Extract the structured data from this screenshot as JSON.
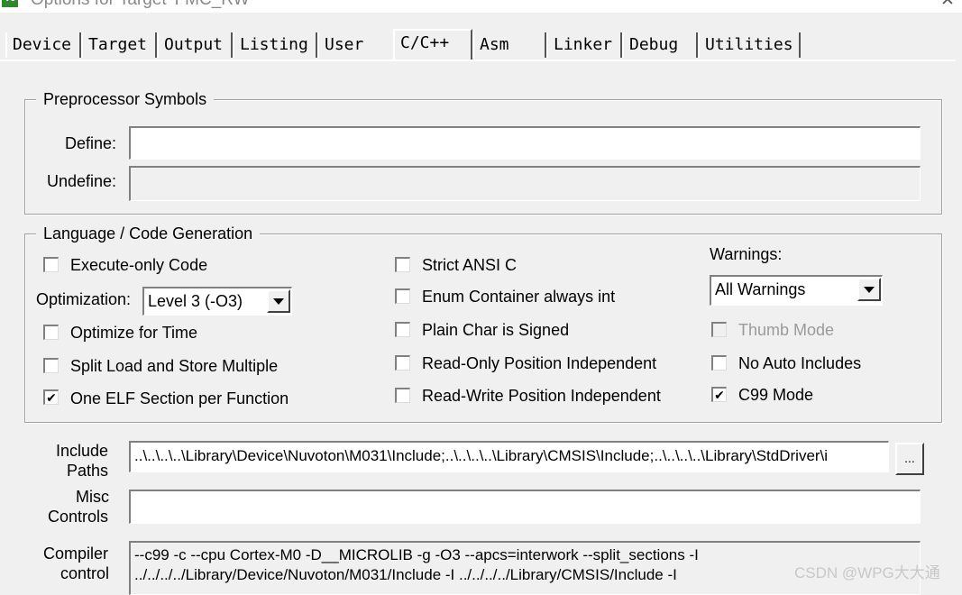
{
  "window": {
    "title": "Options for Target 'FMC_RW'",
    "app_icon": "keil-uvision-icon",
    "close_glyph": "✕"
  },
  "tabs": [
    {
      "label": "Device",
      "active": false
    },
    {
      "label": "Target",
      "active": false
    },
    {
      "label": "Output",
      "active": false
    },
    {
      "label": "Listing",
      "active": false
    },
    {
      "label": "User",
      "active": false
    },
    {
      "label": "C/C++",
      "active": true
    },
    {
      "label": "Asm",
      "active": false
    },
    {
      "label": "Linker",
      "active": false
    },
    {
      "label": "Debug",
      "active": false
    },
    {
      "label": "Utilities",
      "active": false
    }
  ],
  "preprocessor": {
    "title": "Preprocessor Symbols",
    "define_label": "Define:",
    "define_value": "",
    "undefine_label": "Undefine:",
    "undefine_value": ""
  },
  "language": {
    "title": "Language / Code Generation",
    "execute_only": {
      "label": "Execute-only Code",
      "checked": false
    },
    "optimization_label": "Optimization:",
    "optimization_value": "Level 3 (-O3)",
    "optimize_time": {
      "label": "Optimize for Time",
      "checked": false
    },
    "split_load": {
      "label": "Split Load and Store Multiple",
      "checked": false
    },
    "one_elf": {
      "label": "One ELF Section per Function",
      "checked": true
    },
    "strict_ansi": {
      "label": "Strict ANSI C",
      "checked": false
    },
    "enum_container": {
      "label": "Enum Container always int",
      "checked": false
    },
    "plain_char": {
      "label": "Plain Char is Signed",
      "checked": false
    },
    "ro_position": {
      "label": "Read-Only Position Independent",
      "checked": false
    },
    "rw_position": {
      "label": "Read-Write Position Independent",
      "checked": false
    },
    "warnings_label": "Warnings:",
    "warnings_value": "All Warnings",
    "thumb_mode": {
      "label": "Thumb Mode",
      "checked": false,
      "disabled": true
    },
    "no_auto_includes": {
      "label": "No Auto Includes",
      "checked": false
    },
    "c99_mode": {
      "label": "C99 Mode",
      "checked": true
    }
  },
  "include_paths": {
    "label_line1": "Include",
    "label_line2": "Paths",
    "value": "..\\..\\..\\..\\Library\\Device\\Nuvoton\\M031\\Include;..\\..\\..\\..\\Library\\CMSIS\\Include;..\\..\\..\\..\\Library\\StdDriver\\i",
    "browse_label": "..."
  },
  "misc_controls": {
    "label_line1": "Misc",
    "label_line2": "Controls",
    "value": ""
  },
  "compiler_control": {
    "label_line1": "Compiler",
    "label_line2": "control",
    "line1": "--c99 -c --cpu Cortex-M0 -D__MICROLIB -g -O3 --apcs=interwork --split_sections -I",
    "line2": "../../../../Library/Device/Nuvoton/M031/Include -I ../../../../Library/CMSIS/Include -I"
  },
  "watermark": "CSDN @WPG大大通",
  "check_glyph": "✔"
}
